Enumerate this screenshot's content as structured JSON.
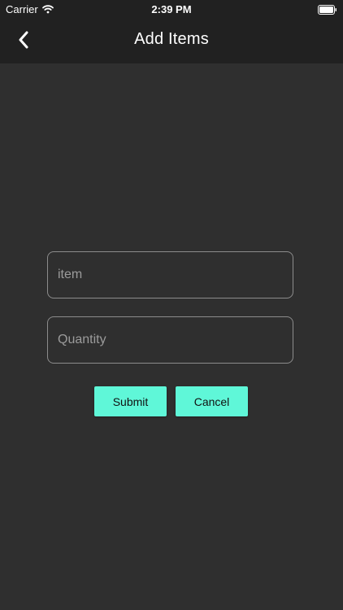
{
  "status_bar": {
    "carrier": "Carrier",
    "time": "2:39 PM"
  },
  "nav": {
    "title": "Add Items",
    "back_icon": "chevron-left-icon"
  },
  "form": {
    "item_placeholder": "item",
    "item_value": "",
    "quantity_placeholder": "Quantity",
    "quantity_value": "",
    "submit_label": "Submit",
    "cancel_label": "Cancel"
  },
  "colors": {
    "background": "#2f2f2f",
    "bar": "#212121",
    "accent": "#5ff7d8",
    "field_border": "#8c8c8c"
  }
}
